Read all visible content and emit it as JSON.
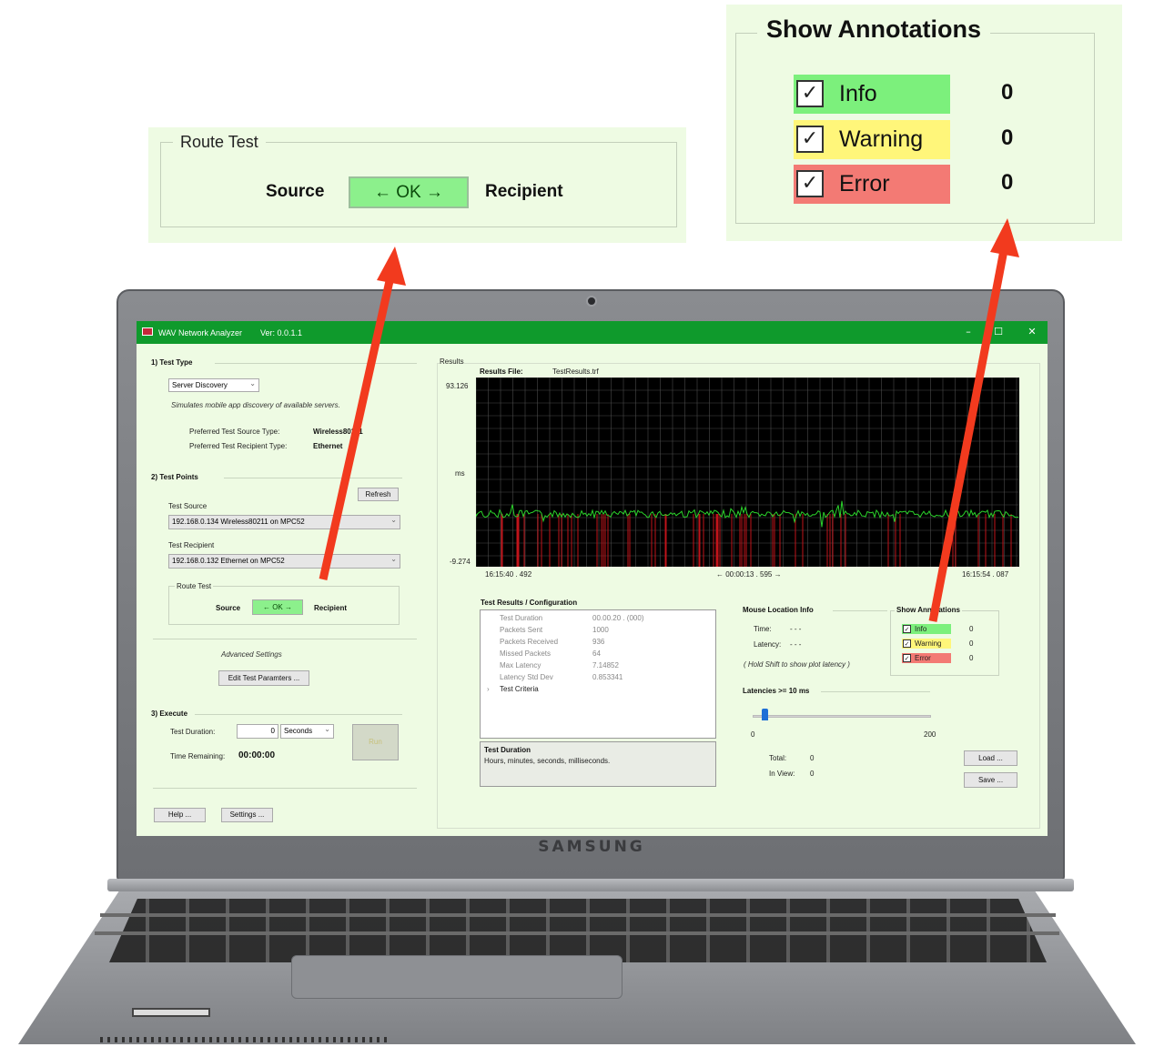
{
  "window": {
    "title": "WAV Network Analyzer",
    "version": "Ver: 0.0.1.1",
    "minimize": "–",
    "maximize": "☐",
    "close": "✕"
  },
  "device": {
    "brand": "SAMSUNG"
  },
  "test_type": {
    "header": "1) Test Type",
    "selected": "Server Discovery",
    "description": "Simulates mobile app discovery of available servers.",
    "source_type_label": "Preferred Test Source Type:",
    "source_type_value": "Wireless80211",
    "recipient_type_label": "Preferred Test Recipient Type:",
    "recipient_type_value": "Ethernet"
  },
  "test_points": {
    "header": "2) Test Points",
    "refresh": "Refresh",
    "source_label": "Test Source",
    "source_value": "192.168.0.134   Wireless80211 on MPC52",
    "recipient_label": "Test Recipient",
    "recipient_value": "192.168.0.132   Ethernet on MPC52"
  },
  "route_test": {
    "title": "Route Test",
    "source": "Source",
    "ok": "← OK →",
    "recipient": "Recipient"
  },
  "advanced": {
    "label": "Advanced Settings",
    "edit_button": "Edit Test Paramters ..."
  },
  "execute": {
    "header": "3) Execute",
    "duration_label": "Test Duration:",
    "duration_value": "0",
    "duration_unit": "Seconds",
    "run": "Run",
    "remaining_label": "Time Remaining:",
    "remaining_value": "00:00:00"
  },
  "footer_buttons": {
    "help": "Help ...",
    "settings": "Settings ..."
  },
  "results": {
    "section_label": "Results",
    "file_label": "Results File:",
    "file_value": "TestResults.trf"
  },
  "chart_data": {
    "type": "line",
    "ylabel": "ms",
    "ylim": [
      -9.274,
      93.126
    ],
    "ytick_labels": [
      "93.126",
      "-9.274"
    ],
    "xtick_labels": [
      "16:15:40 . 492",
      "← 00:00:13 . 595 →",
      "16:15:54 . 087"
    ],
    "series": [],
    "background": "#000000",
    "line_color": "#2bd42b",
    "marker_color": "#c0141a",
    "grid": true
  },
  "config": {
    "header": "Test Results / Configuration",
    "rows": [
      {
        "name": "Test Duration",
        "value": "00.00.20 . (000)"
      },
      {
        "name": "Packets Sent",
        "value": "1000"
      },
      {
        "name": "Packets Received",
        "value": "936"
      },
      {
        "name": "Missed Packets",
        "value": "64"
      },
      {
        "name": "Max Latency",
        "value": "7.14852"
      },
      {
        "name": "Latency Std Dev",
        "value": "0.853341"
      }
    ],
    "criteria": "Test Criteria",
    "desc_title": "Test Duration",
    "desc_text": "Hours, minutes, seconds, milliseconds."
  },
  "mouse_info": {
    "header": "Mouse Location Info",
    "time_label": "Time:",
    "time_value": "- - -",
    "latency_label": "Latency:",
    "latency_value": "- - -",
    "hint": "( Hold Shift to show plot latency )"
  },
  "annotations": {
    "header": "Show Annotations",
    "items": [
      {
        "label": "Info",
        "count": "0",
        "color": "#7cf07c"
      },
      {
        "label": "Warning",
        "count": "0",
        "color": "#fff67a"
      },
      {
        "label": "Error",
        "count": "0",
        "color": "#f37a74"
      }
    ]
  },
  "latency_filter": {
    "label": "Latencies >= 10 ms",
    "min": "0",
    "max": "200",
    "level_fraction": 0.05,
    "total_label": "Total:",
    "total_value": "0",
    "inview_label": "In View:",
    "inview_value": "0",
    "load": "Load ...",
    "save": "Save ..."
  },
  "callout_colors": {
    "arrow": "#f23a1e",
    "panel_bg": "#eefbe3"
  }
}
